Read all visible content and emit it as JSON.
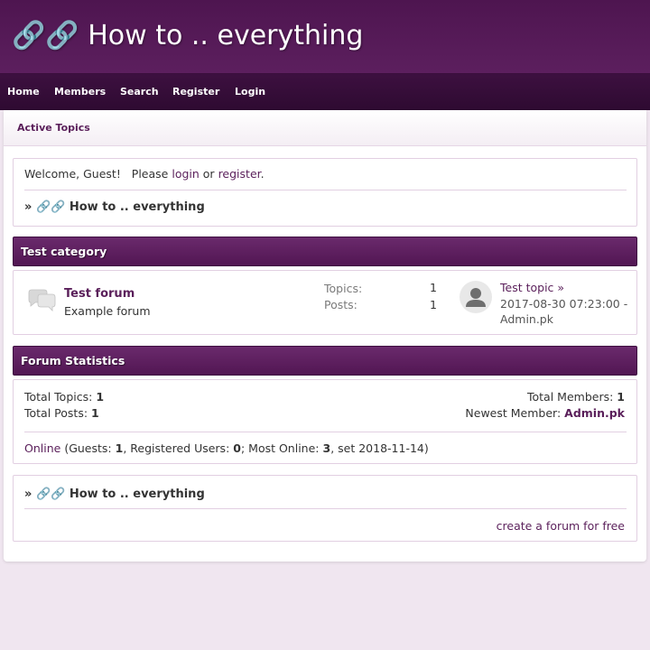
{
  "site": {
    "title": "🔗🔗 How to .. everything"
  },
  "nav": {
    "items": [
      "Home",
      "Members",
      "Search",
      "Register",
      "Login"
    ]
  },
  "subnav": {
    "active": "Active Topics"
  },
  "welcome": {
    "text": "Welcome, Guest!",
    "please": "Please",
    "login_link": "login",
    "or": "or",
    "register_link": "register",
    "period": "."
  },
  "breadcrumb": {
    "prefix": "»",
    "glyphs": "🔗🔗",
    "label": "How to .. everything"
  },
  "category": {
    "title": "Test category",
    "forum": {
      "name": "Test forum",
      "description": "Example forum",
      "topics_label": "Topics:",
      "topics_value": "1",
      "posts_label": "Posts:",
      "posts_value": "1",
      "last_post": {
        "topic": "Test topic",
        "arrow": "»",
        "datetime": "2017-08-30 07:23:00 -",
        "user": "Admin.pk"
      }
    }
  },
  "stats": {
    "title": "Forum Statistics",
    "total_topics_label": "Total Topics:",
    "total_topics": "1",
    "total_posts_label": "Total Posts:",
    "total_posts": "1",
    "total_members_label": "Total Members:",
    "total_members": "1",
    "newest_member_label": "Newest Member:",
    "newest_member": "Admin.pk",
    "online_link": "Online",
    "guests_label": "(Guests:",
    "guests": "1",
    "registered_label": ", Registered Users:",
    "registered": "0",
    "most_online_label": "; Most Online:",
    "most_online": "3",
    "set_label": ", set 2018-11-14)"
  },
  "footer": {
    "create_link": "create a forum for free"
  },
  "colors": {
    "header": "#5c1f5e",
    "nav": "#2e0a31",
    "bar": "#5e1f60",
    "link": "#5a1f5a",
    "page_bg": "#f0e6f0"
  }
}
